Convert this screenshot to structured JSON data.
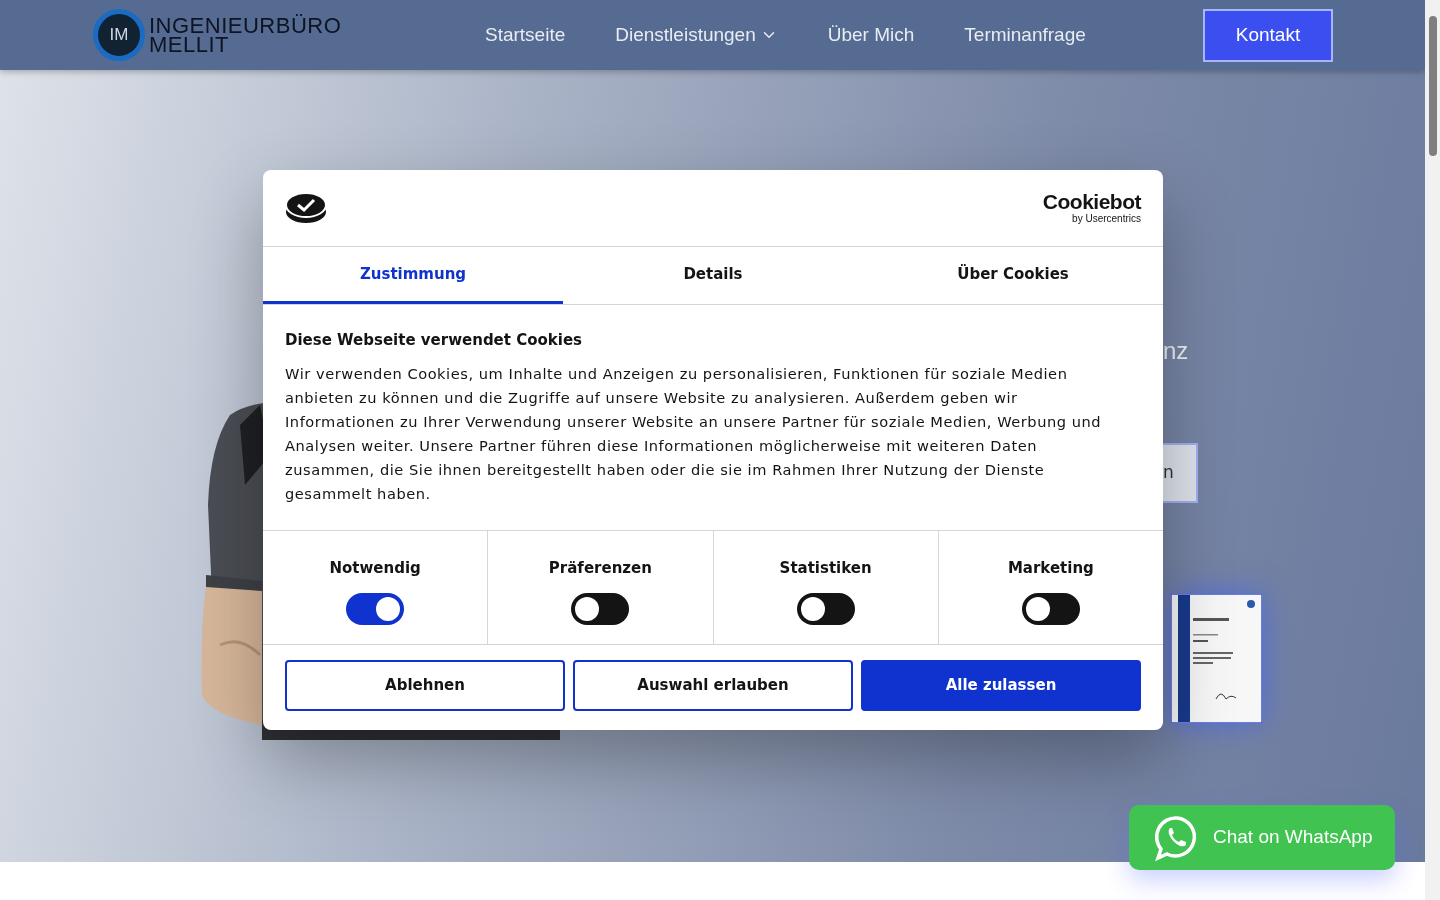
{
  "header": {
    "logo": {
      "monogram": "IM",
      "line1": "INGENIEURBÜRO",
      "line2": "MELLIT"
    },
    "nav": [
      {
        "label": "Startseite",
        "dropdown": false
      },
      {
        "label": "Dienstleistungen",
        "dropdown": true
      },
      {
        "label": "Über Mich",
        "dropdown": false
      },
      {
        "label": "Terminanfrage",
        "dropdown": false
      }
    ],
    "cta": "Kontakt"
  },
  "hero": {
    "heading_fragment": "nz",
    "button_fragment": "n"
  },
  "cookie_dialog": {
    "brand": {
      "name": "Cookiebot",
      "byline": "by Usercentrics"
    },
    "tabs": [
      {
        "label": "Zustimmung",
        "selected": true
      },
      {
        "label": "Details",
        "selected": false
      },
      {
        "label": "Über Cookies",
        "selected": false
      }
    ],
    "title": "Diese Webseite verwendet Cookies",
    "body": "Wir verwenden Cookies, um Inhalte und Anzeigen zu personalisieren, Funktionen für soziale Medien anbieten zu können und die Zugriffe auf unsere Website zu analysieren. Außerdem geben wir Informationen zu Ihrer Verwendung unserer Website an unsere Partner für soziale Medien, Werbung und Analysen weiter. Unsere Partner führen diese Informationen möglicherweise mit weiteren Daten zusammen, die Sie ihnen bereitgestellt haben oder die sie im Rahmen Ihrer Nutzung der Dienste gesammelt haben.",
    "categories": [
      {
        "label": "Notwendig",
        "on": true
      },
      {
        "label": "Präferenzen",
        "on": false
      },
      {
        "label": "Statistiken",
        "on": false
      },
      {
        "label": "Marketing",
        "on": false
      }
    ],
    "buttons": [
      {
        "label": "Ablehnen",
        "kind": "outline"
      },
      {
        "label": "Auswahl erlauben",
        "kind": "outline"
      },
      {
        "label": "Alle zulassen",
        "kind": "primary"
      }
    ]
  },
  "whatsapp": {
    "label": "Chat on WhatsApp"
  }
}
